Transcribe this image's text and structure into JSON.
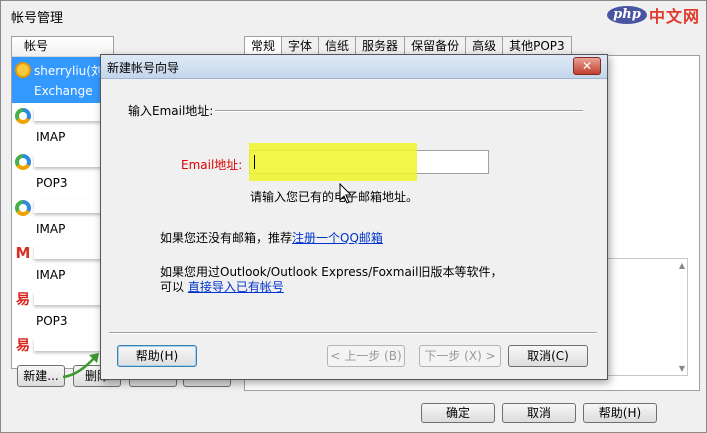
{
  "window": {
    "title": "帐号管理",
    "close_glyph": "✕"
  },
  "watermark": {
    "logo": "php",
    "text": "中文网"
  },
  "accounts": {
    "header": "帐号",
    "items": [
      {
        "name": "sherryliu(刘",
        "type": "Exchange",
        "icon": "outlook-icon"
      },
      {
        "name": "",
        "type": "IMAP",
        "icon": "mail-app-icon"
      },
      {
        "name": "",
        "type": "POP3",
        "icon": "mail-app-icon"
      },
      {
        "name": "",
        "type": "IMAP",
        "icon": "mail-app-icon"
      },
      {
        "name": "",
        "type": "IMAP",
        "icon": "gmail-icon"
      },
      {
        "name": "",
        "type": "POP3",
        "icon": "netease-163-icon"
      },
      {
        "name": "",
        "type": "",
        "icon": "netease-163-icon"
      }
    ],
    "new_button": "新建...",
    "delete_button": "删除"
  },
  "tabs": [
    "常规",
    "字体",
    "信纸",
    "服务器",
    "保留备份",
    "高级",
    "其他POP3"
  ],
  "footer": {
    "ok": "确定",
    "cancel": "取消",
    "help": "帮助(H)"
  },
  "wizard": {
    "title": "新建帐号向导",
    "close_glyph": "✕",
    "section_label": "输入Email地址:",
    "email_label": "Email地址:",
    "email_value": "",
    "hint_text": "请输入您已有的电子邮箱地址。",
    "no_mail_text": "如果您还没有邮箱，推荐",
    "register_link": "注册一个QQ邮箱",
    "import_text_1": "如果您用过Outlook/Outlook Express/Foxmail旧版本等软件，",
    "import_text_2": "可以",
    "import_link": "直接导入已有帐号",
    "help_button": "帮助(H)",
    "back_button": "< 上一步 (B)",
    "next_button": "下一步 (X) >",
    "cancel_button": "取消(C)"
  },
  "colors": {
    "selection": "#3399ff",
    "highlight": "#f0f528",
    "error_label": "#e00000",
    "link": "#0033cc"
  }
}
